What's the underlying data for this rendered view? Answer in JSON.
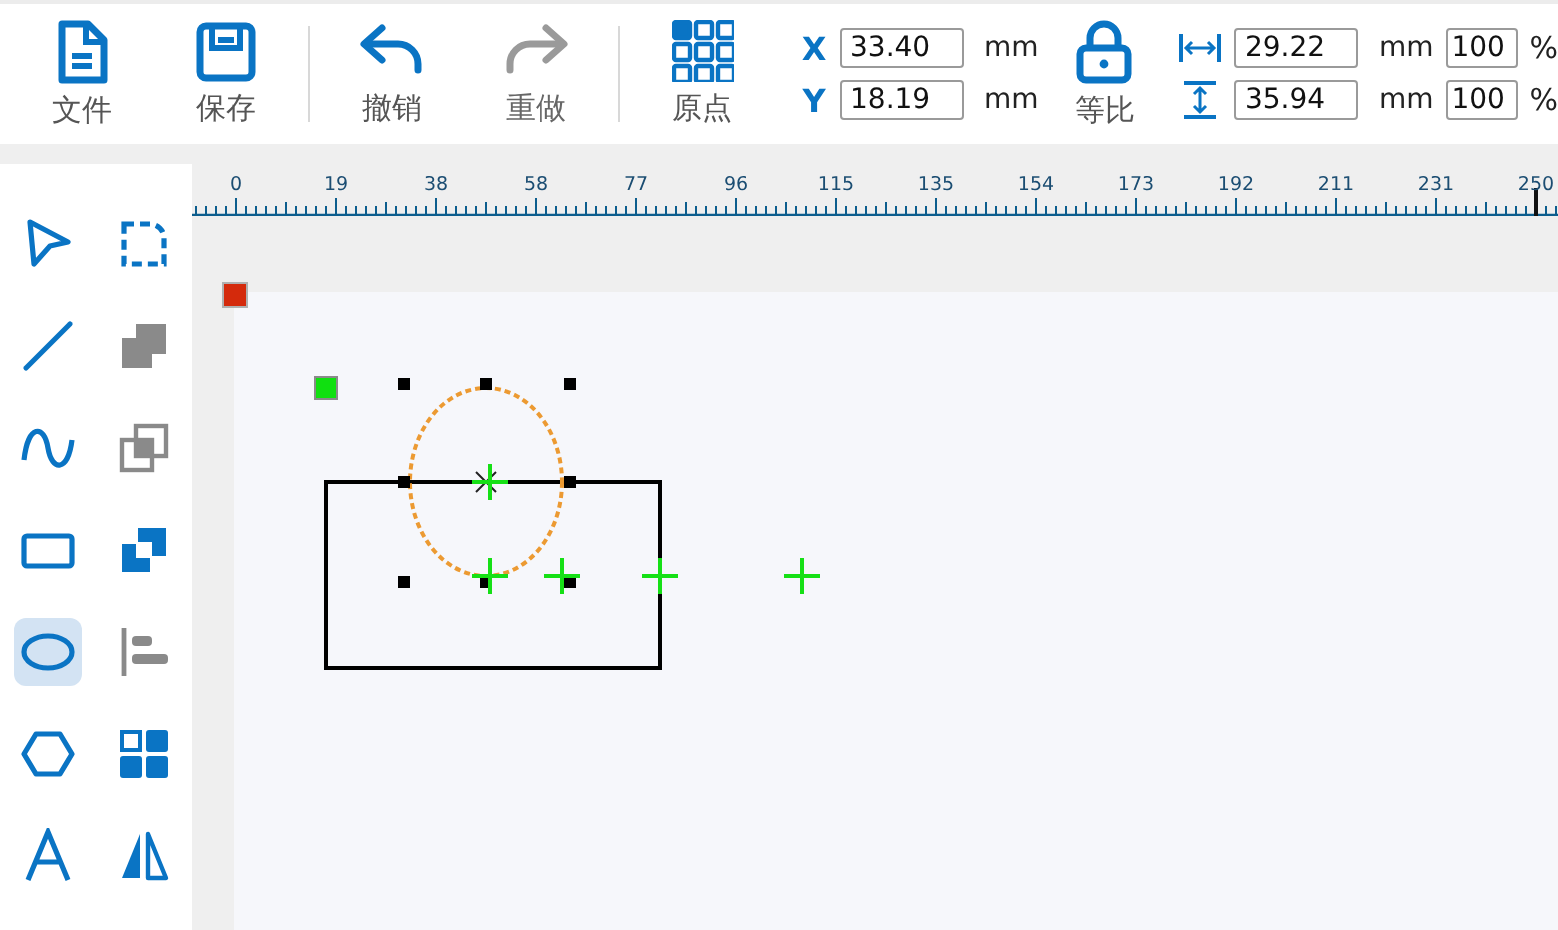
{
  "toolbar_groups": [
    {
      "buttons": [
        {
          "kind": "file",
          "label": "文件",
          "disabled": false
        },
        {
          "kind": "save",
          "label": "保存",
          "disabled": false
        }
      ]
    },
    {
      "buttons": [
        {
          "kind": "undo",
          "label": "撤销",
          "disabled": false
        },
        {
          "kind": "redo",
          "label": "重做",
          "disabled": true
        }
      ]
    },
    {
      "buttons": [
        {
          "kind": "origin",
          "label": "原点",
          "disabled": false
        }
      ]
    }
  ],
  "position": [
    {
      "axis": "X",
      "value": "33.40",
      "unit": "mm"
    },
    {
      "axis": "Y",
      "value": "18.19",
      "unit": "mm"
    }
  ],
  "lock": {
    "label": "等比",
    "locked": true
  },
  "size": [
    {
      "kind": "width",
      "value": "29.22",
      "unit": "mm",
      "percent": "100",
      "percent_unit": "%"
    },
    {
      "kind": "height",
      "value": "35.94",
      "unit": "mm",
      "percent": "100",
      "percent_unit": "%"
    }
  ],
  "ruler": {
    "labels": [
      "0",
      "19",
      "38",
      "58",
      "77",
      "96",
      "115",
      "135",
      "154",
      "173",
      "192",
      "211",
      "231",
      "250"
    ]
  },
  "tools": [
    {
      "kind": "select",
      "selected": false
    },
    {
      "kind": "node-edit",
      "selected": false
    },
    {
      "kind": "line",
      "selected": false
    },
    {
      "kind": "union",
      "selected": false
    },
    {
      "kind": "curve",
      "selected": false
    },
    {
      "kind": "intersect",
      "selected": false
    },
    {
      "kind": "rectangle",
      "selected": false
    },
    {
      "kind": "exclude",
      "selected": false
    },
    {
      "kind": "ellipse",
      "selected": true
    },
    {
      "kind": "align",
      "selected": false
    },
    {
      "kind": "polygon",
      "selected": false
    },
    {
      "kind": "array",
      "selected": false
    },
    {
      "kind": "text",
      "selected": false
    },
    {
      "kind": "mirror",
      "selected": false
    }
  ]
}
